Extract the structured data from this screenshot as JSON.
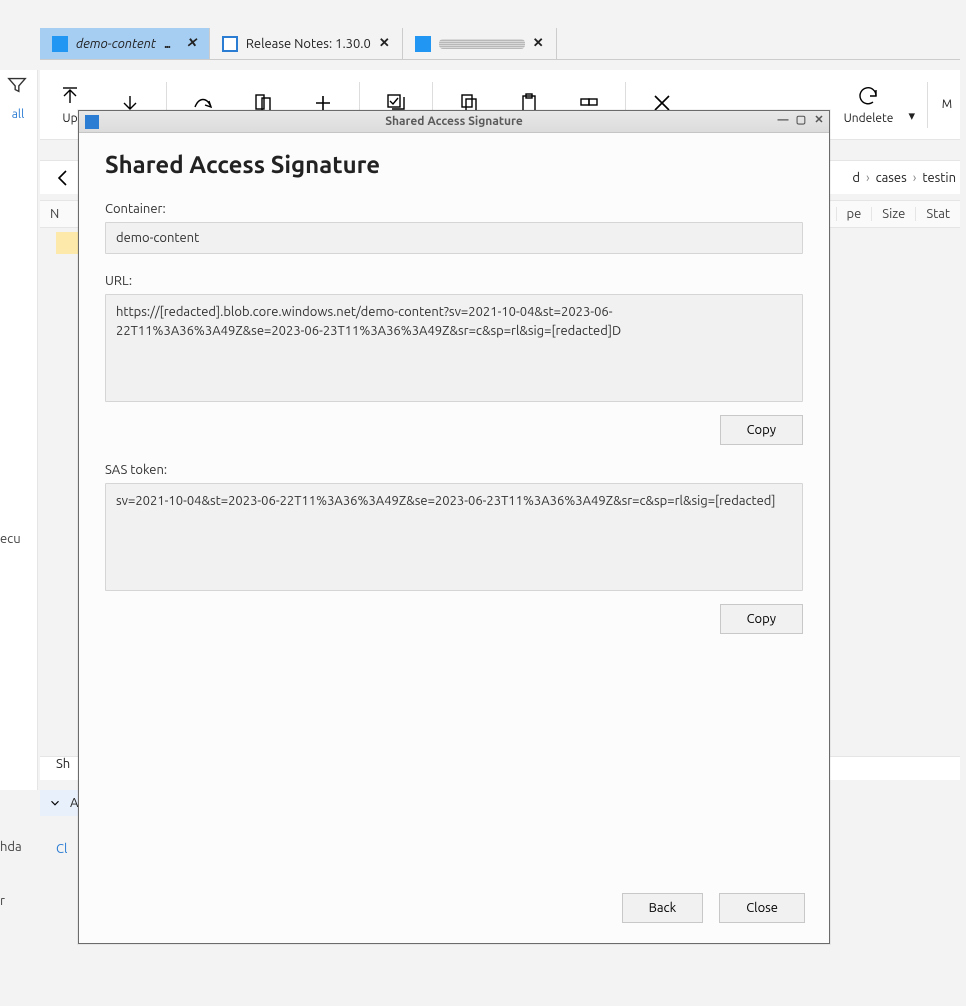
{
  "tabs": [
    {
      "label": "demo-content",
      "active": true
    },
    {
      "label": "Release Notes: 1.30.0",
      "active": false
    },
    {
      "label": "",
      "active": false
    }
  ],
  "toolbar": {
    "upload": "Up",
    "undelete": "Undelete",
    "more": "M"
  },
  "left_gutter": {
    "clear_all": "all"
  },
  "breadcrumb": {
    "part_d": "d",
    "cases": "cases",
    "testin": "testin"
  },
  "table_headers": {
    "n": "N",
    "pe": "pe",
    "size": "Size",
    "stat": "Stat"
  },
  "status": {
    "sh": "Sh"
  },
  "activities": {
    "label": "Activ",
    "clear": "Cl"
  },
  "side": {
    "ecu": "ecu",
    "hda": "hda",
    "r": "r"
  },
  "dialog": {
    "window_title": "Shared Access Signature",
    "heading": "Shared Access Signature",
    "container_label": "Container:",
    "container_value": "demo-content",
    "url_label": "URL:",
    "url_value": "https://[redacted].blob.core.windows.net/demo-content?sv=2021-10-04&st=2023-06-22T11%3A36%3A49Z&se=2023-06-23T11%3A36%3A49Z&sr=c&sp=rl&sig=[redacted]D",
    "sas_label": "SAS token:",
    "sas_value": "sv=2021-10-04&st=2023-06-22T11%3A36%3A49Z&se=2023-06-23T11%3A36%3A49Z&sr=c&sp=rl&sig=[redacted]",
    "copy": "Copy",
    "back": "Back",
    "close": "Close"
  }
}
